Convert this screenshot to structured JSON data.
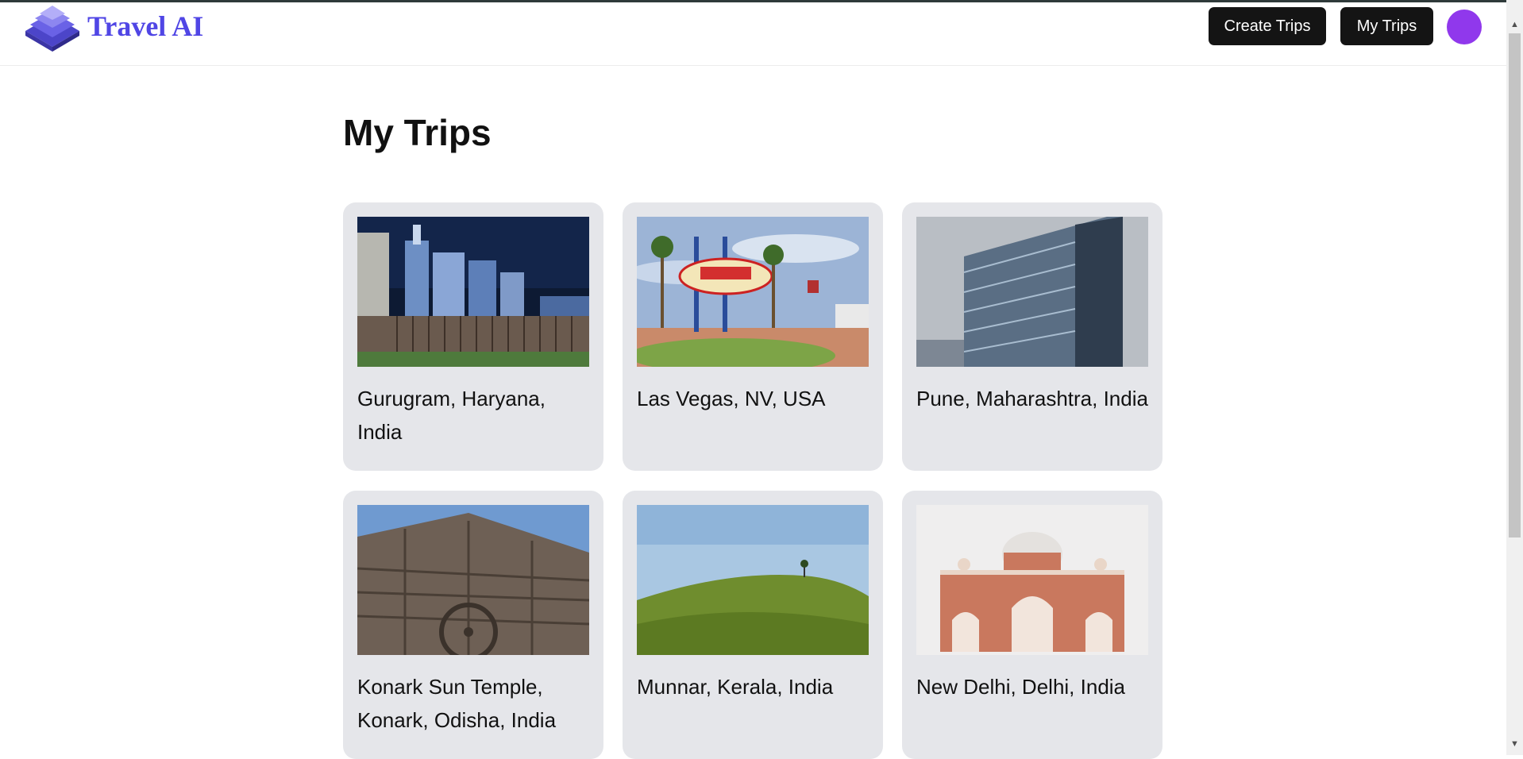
{
  "header": {
    "logo_text": "Travel AI",
    "create_trips_label": "Create Trips",
    "my_trips_label": "My Trips",
    "avatar_color": "#9038ec",
    "brand_color": "#5046e5"
  },
  "main": {
    "title": "My Trips",
    "trips": [
      {
        "name": "Gurugram, Haryana, India",
        "image": "city-skyline-night"
      },
      {
        "name": "Las Vegas, NV, USA",
        "image": "las-vegas-sign"
      },
      {
        "name": "Pune, Maharashtra, India",
        "image": "glass-office-building"
      },
      {
        "name": "Konark Sun Temple, Konark, Odisha, India",
        "image": "stone-temple-wheel"
      },
      {
        "name": "Munnar, Kerala, India",
        "image": "tea-plantation-hill"
      },
      {
        "name": "New Delhi, Delhi, India",
        "image": "humayun-tomb"
      }
    ]
  }
}
